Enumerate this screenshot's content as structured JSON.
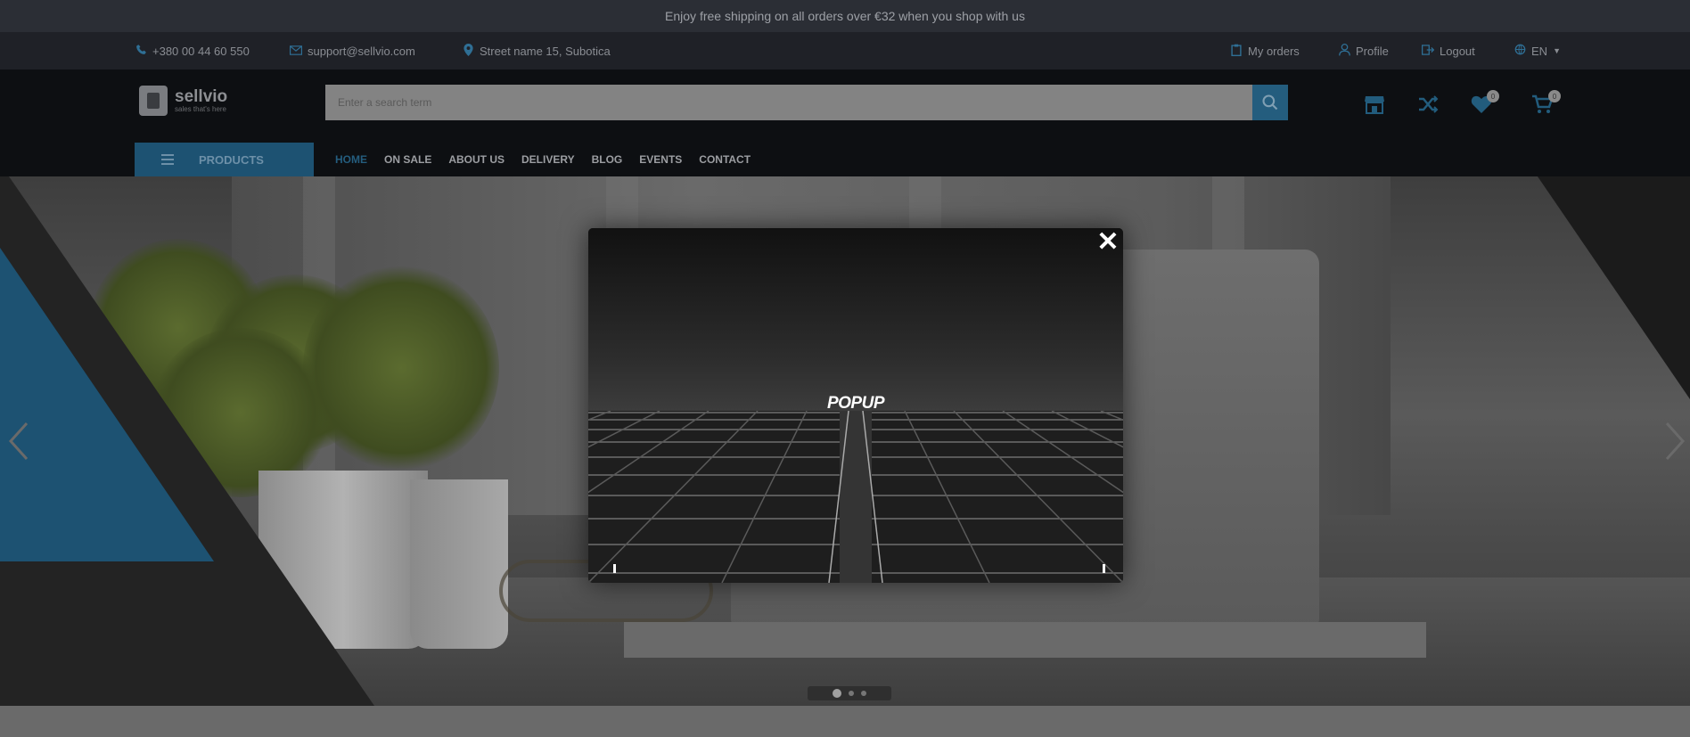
{
  "announcement": "Enjoy free shipping on all orders over €32 when you shop with us",
  "topbar": {
    "phone": "+380 00 44 60 550",
    "email": "support@sellvio.com",
    "address": "Street name 15, Subotica",
    "my_orders": "My orders",
    "profile": "Profile",
    "logout": "Logout",
    "language": "EN"
  },
  "header": {
    "logo_name": "sellvio",
    "logo_tagline": "sales that's here",
    "search_placeholder": "Enter a search term",
    "wishlist_count": "0",
    "cart_count": "0"
  },
  "nav": {
    "products_label": "PRODUCTS",
    "items": [
      "HOME",
      "ON SALE",
      "ABOUT US",
      "DELIVERY",
      "BLOG",
      "EVENTS",
      "CONTACT"
    ]
  },
  "slider": {
    "active_slide": 1,
    "slide_count": 3
  },
  "modal": {
    "title": "POPUP",
    "close_symbol": "✕"
  },
  "colors": {
    "accent": "#245d7e",
    "overlay_dark": "#0d0f12"
  }
}
